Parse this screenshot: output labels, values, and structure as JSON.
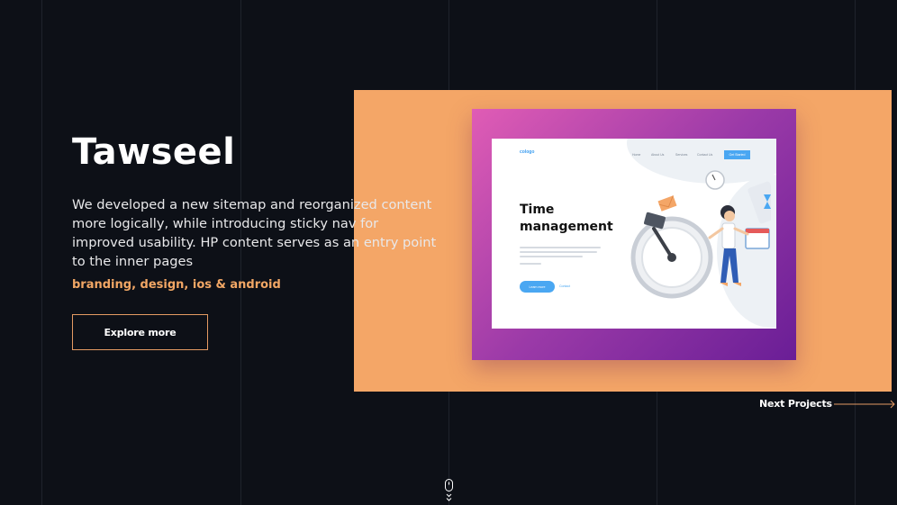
{
  "project": {
    "title": "Tawseel",
    "description": "We developed a new sitemap and reorganized content more logically, while introducing sticky nav for improved usability. HP content serves as an entry point to the inner pages",
    "tags": "branding, design, ios & android",
    "cta_label": "Explore more"
  },
  "mockup": {
    "logo": "cologo",
    "nav": [
      "Home",
      "About Us",
      "Services",
      "Contact Us"
    ],
    "nav_button": "Get Started",
    "headline_line1": "Time",
    "headline_line2": "management",
    "learn_button": "Learn more",
    "contact_link": "Contact"
  },
  "navigation": {
    "next_label": "Next Projects"
  },
  "colors": {
    "background": "#0d1017",
    "accent": "#f2a765",
    "showcase_bg": "#f4a667",
    "card_gradient_start": "#e05cb5",
    "card_gradient_end": "#6a1e96",
    "mockup_blue": "#4aa7f2"
  },
  "icons": {
    "scroll": "mouse-scroll-icon",
    "next": "long-arrow-right-icon"
  }
}
